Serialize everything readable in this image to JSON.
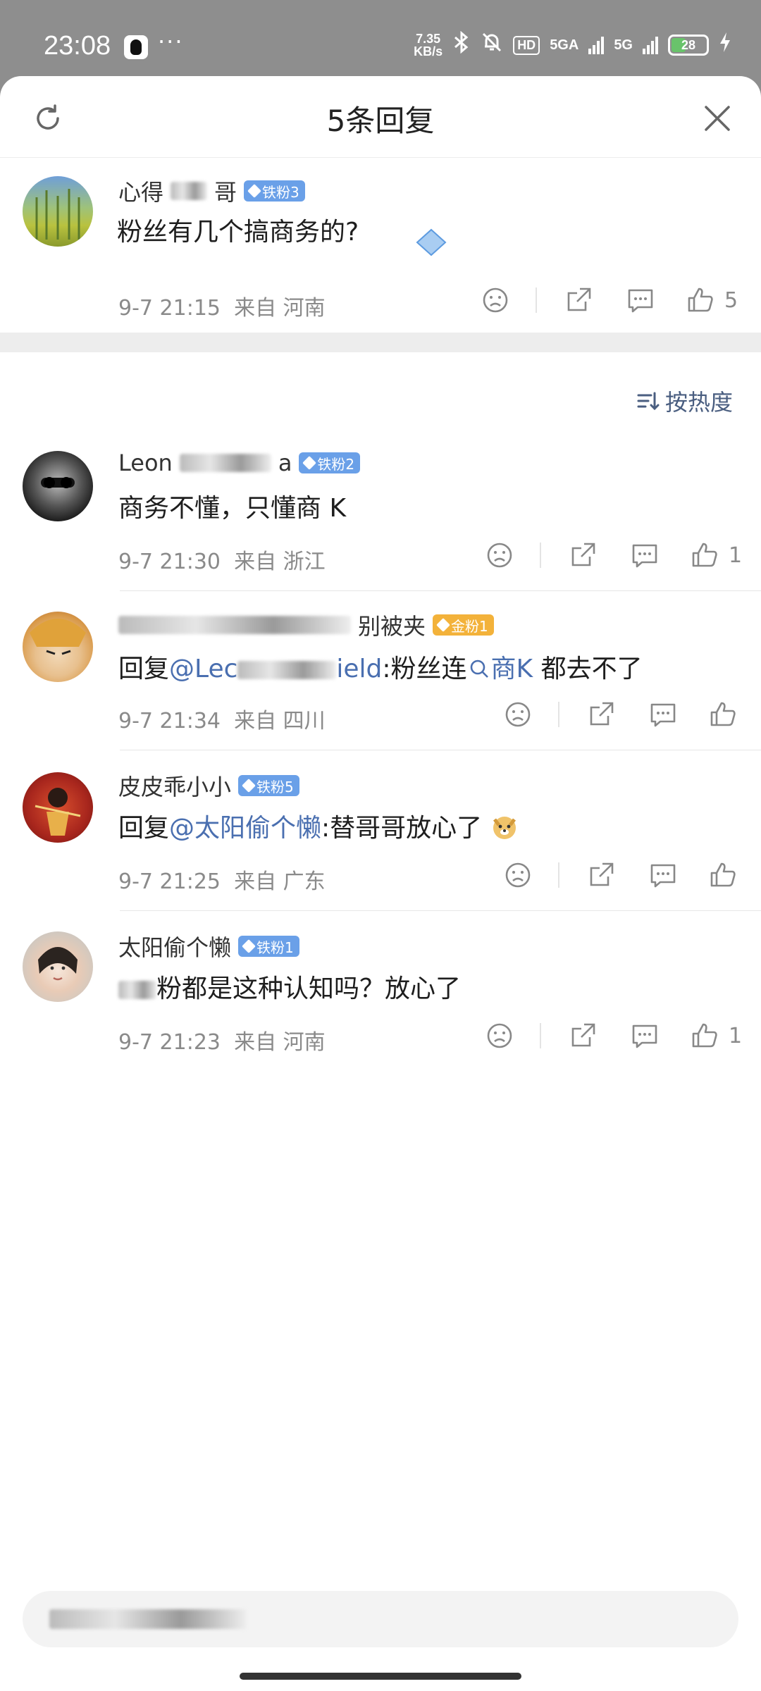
{
  "status_bar": {
    "time": "23:08",
    "dots": "···",
    "speed_top": "7.35",
    "speed_bottom": "KB/s",
    "hd": "HD",
    "net1": "5GA",
    "net2": "5G",
    "battery": "28"
  },
  "header": {
    "title": "5条回复"
  },
  "main_comment": {
    "name_a": "心得",
    "name_b": "哥",
    "badge": "铁粉3",
    "text": "粉丝有几个搞商务的?",
    "time": "9-7 21:15",
    "from": "来自 河南",
    "likes": "5"
  },
  "sort_label": "按热度",
  "replies": [
    {
      "name_a": "Leon",
      "name_b": "a",
      "badge": "铁粉2",
      "text": "商务不懂，只懂商 K",
      "time": "9-7 21:30",
      "from": "来自 浙江",
      "likes": "1"
    },
    {
      "name_b": "别被夹",
      "badge": "金粉1",
      "text_prefix": "回复",
      "mention_a": "@Lec",
      "mention_b": "ield",
      "text_mid": ":粉丝连",
      "search_link": "商K",
      "text_suffix": " 都去不了",
      "time": "9-7 21:34",
      "from": "来自 四川"
    },
    {
      "name": "皮皮乖小小",
      "badge": "铁粉5",
      "text_prefix": "回复",
      "mention": "@太阳偷个懒",
      "text_suffix": ":替哥哥放心了",
      "time": "9-7 21:25",
      "from": "来自 广东"
    },
    {
      "name": "太阳偷个懒",
      "badge": "铁粉1",
      "text": "粉都是这种认知吗？放心了",
      "time": "9-7 21:23",
      "from": "来自 河南",
      "likes": "1"
    }
  ],
  "colors": {
    "badge_blue": "#6aa0e8",
    "badge_gold": "#f3b23a",
    "link": "#4a6fb0"
  }
}
